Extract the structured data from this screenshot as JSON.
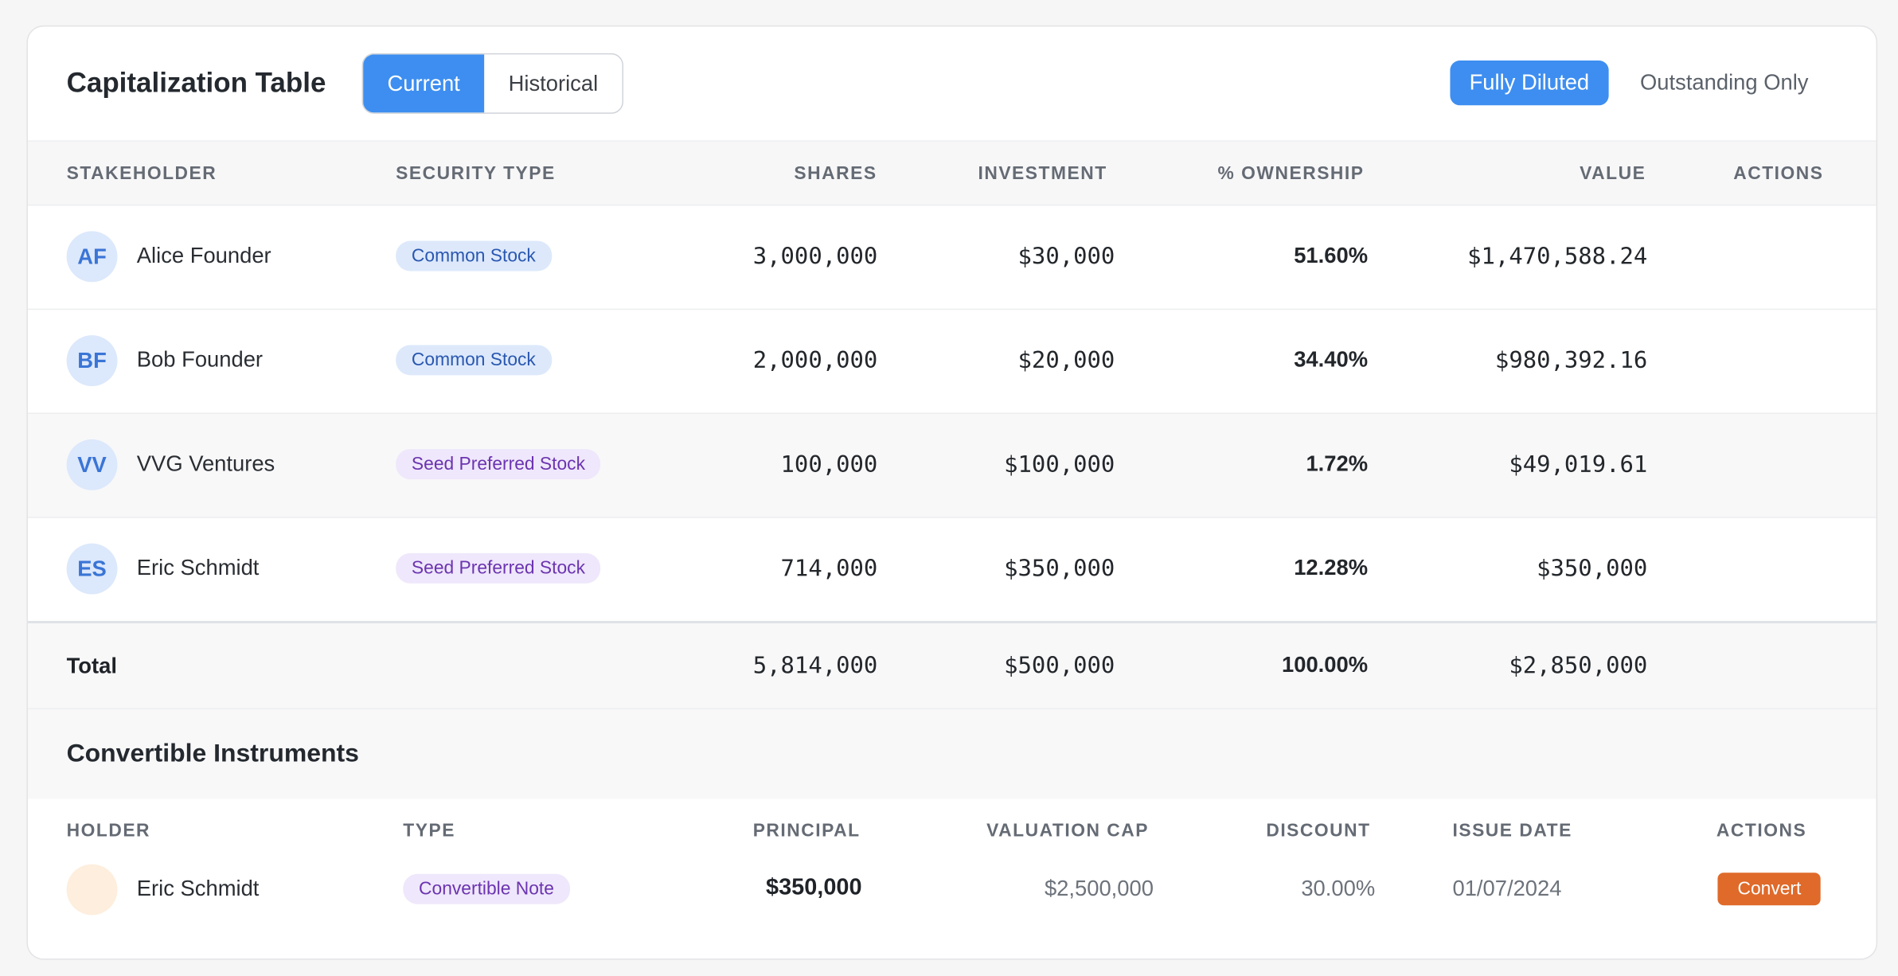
{
  "header": {
    "title": "Capitalization Table",
    "tabs": [
      "Current",
      "Historical"
    ],
    "active_tab": "Current",
    "view_options": [
      "Fully Diluted",
      "Outstanding Only"
    ],
    "active_view": "Fully Diluted"
  },
  "columns": [
    "STAKEHOLDER",
    "SECURITY TYPE",
    "SHARES",
    "INVESTMENT",
    "% OWNERSHIP",
    "VALUE",
    "ACTIONS"
  ],
  "rows": [
    {
      "initials": "AF",
      "name": "Alice Founder",
      "security": "Common Stock",
      "shares": "3,000,000",
      "investment": "$30,000",
      "ownership": "51.60%",
      "value": "$1,470,588.24"
    },
    {
      "initials": "BF",
      "name": "Bob Founder",
      "security": "Common Stock",
      "shares": "2,000,000",
      "investment": "$20,000",
      "ownership": "34.40%",
      "value": "$980,392.16"
    },
    {
      "initials": "VV",
      "name": "VVG Ventures",
      "security": "Seed Preferred Stock",
      "shares": "100,000",
      "investment": "$100,000",
      "ownership": "1.72%",
      "value": "$49,019.61"
    },
    {
      "initials": "ES",
      "name": "Eric Schmidt",
      "security": "Seed Preferred Stock",
      "shares": "714,000",
      "investment": "$350,000",
      "ownership": "12.28%",
      "value": "$350,000"
    }
  ],
  "total": {
    "label": "Total",
    "shares": "5,814,000",
    "investment": "$500,000",
    "ownership": "100.00%",
    "value": "$2,850,000"
  },
  "convertibles": {
    "title": "Convertible Instruments",
    "columns": [
      "HOLDER",
      "TYPE",
      "PRINCIPAL",
      "VALUATION CAP",
      "DISCOUNT",
      "ISSUE DATE",
      "ACTIONS"
    ],
    "rows": [
      {
        "name": "Eric Schmidt",
        "type": "Convertible Note",
        "principal": "$350,000",
        "valuation_cap": "$2,500,000",
        "discount": "30.00%",
        "issue_date": "01/07/2024",
        "action": "Convert"
      }
    ]
  },
  "colors": {
    "accent": "#3d8ef0",
    "convert": "#df6a2a"
  }
}
